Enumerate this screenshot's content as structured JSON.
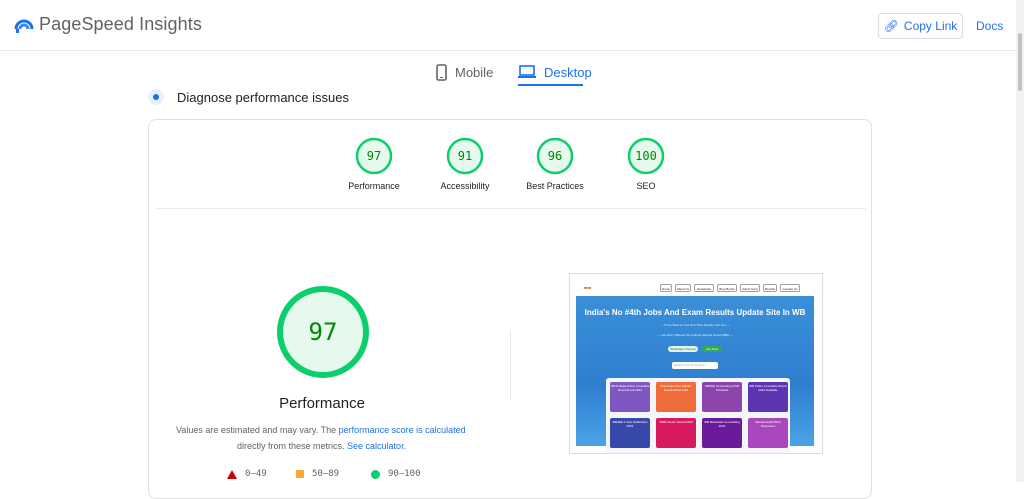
{
  "header": {
    "title": "PageSpeed Insights",
    "copy_link_label": "Copy Link",
    "docs_label": "Docs"
  },
  "tabs": [
    {
      "label": "Mobile",
      "active": false
    },
    {
      "label": "Desktop",
      "active": true
    }
  ],
  "diagnose_title": "Diagnose performance issues",
  "scores": [
    {
      "value": "97",
      "label": "Performance"
    },
    {
      "value": "91",
      "label": "Accessibility"
    },
    {
      "value": "96",
      "label": "Best Practices"
    },
    {
      "value": "100",
      "label": "SEO"
    }
  ],
  "main_score": {
    "value": "97",
    "label": "Performance"
  },
  "note": {
    "prefix": "Values are estimated and may vary. The ",
    "link1": "performance score is calculated",
    "middle": "directly from these metrics. ",
    "link2": "See calculator."
  },
  "legend": [
    {
      "range": "0–49",
      "shape": "triangle",
      "color": "#cc0000"
    },
    {
      "range": "50–89",
      "shape": "square",
      "color": "#ffaa33"
    },
    {
      "range": "90–100",
      "shape": "circle",
      "color": "#0cce6b"
    }
  ],
  "colors": {
    "accent": "#1a73e8",
    "pass": "#0cce6b",
    "pass_text": "#008800"
  },
  "screenshot": {
    "headline": "India's No #4th Jobs And Exam Results Update Site In WB",
    "subline1": "--- If You Want to Your Self Then Quickly Join Our ---",
    "subline2": "--- Job Entry Different By College Stipend Group WBA ---",
    "pill1": "Whatsapp Channel",
    "pill2": "Join Now",
    "search_placeholder": "Search Your Post Here...",
    "nav": [
      "Home",
      "About Us",
      "Newsletter",
      "Best Books",
      "Admit Card",
      "Results",
      "Contact Us"
    ],
    "cards": [
      "WB Kolkata Police Constable Recruitment 2024",
      "Download Free Sarkari Result Admit Card",
      "WBJEE Counselling 2024 Schedule",
      "WB Police Constable Result 2024 Available",
      "WBJEE 1 Year Notification 2024",
      "TMBU Exam Result 2024",
      "WB Madrasah Counselling 2024",
      "Mental Health Brief Discussion"
    ]
  }
}
